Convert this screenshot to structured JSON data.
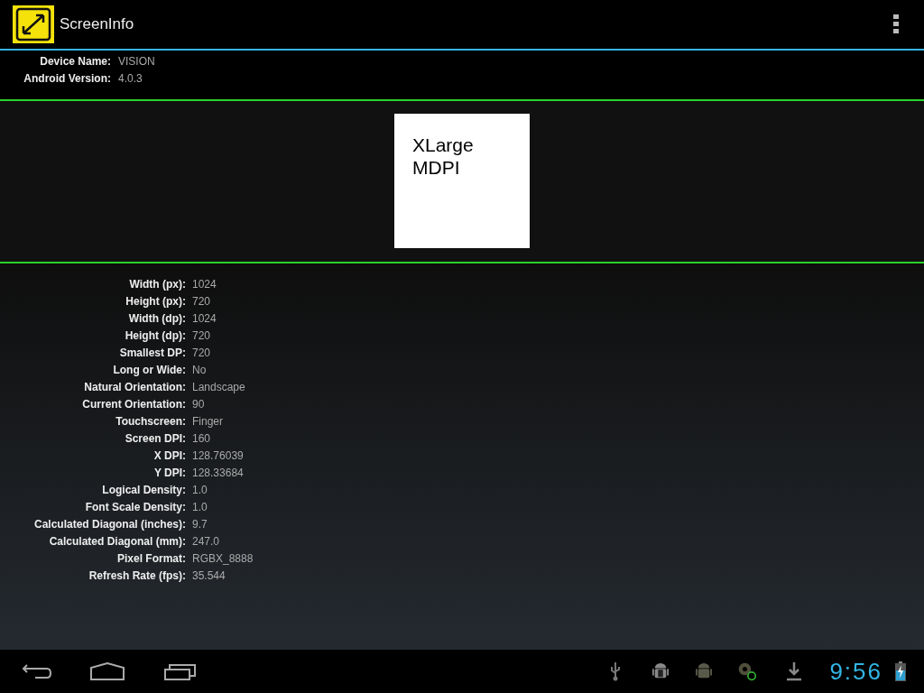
{
  "action_bar": {
    "title": "ScreenInfo"
  },
  "device_info": [
    {
      "label": "Device Name:",
      "value": "VISION"
    },
    {
      "label": "Android Version:",
      "value": "4.0.3"
    }
  ],
  "screen_class": {
    "size": "XLarge",
    "density": "MDPI"
  },
  "properties": [
    {
      "label": "Width (px):",
      "value": "1024"
    },
    {
      "label": "Height (px):",
      "value": "720"
    },
    {
      "label": "Width (dp):",
      "value": "1024"
    },
    {
      "label": "Height (dp):",
      "value": "720"
    },
    {
      "label": "Smallest DP:",
      "value": "720"
    },
    {
      "label": "Long or Wide:",
      "value": "No"
    },
    {
      "label": "Natural Orientation:",
      "value": "Landscape"
    },
    {
      "label": "Current Orientation:",
      "value": "90"
    },
    {
      "label": "Touchscreen:",
      "value": "Finger"
    },
    {
      "label": "Screen DPI:",
      "value": "160"
    },
    {
      "label": "X DPI:",
      "value": "128.76039"
    },
    {
      "label": "Y DPI:",
      "value": "128.33684"
    },
    {
      "label": "Logical Density:",
      "value": "1.0"
    },
    {
      "label": "Font Scale Density:",
      "value": "1.0"
    },
    {
      "label": "Calculated Diagonal (inches):",
      "value": "9.7"
    },
    {
      "label": "Calculated Diagonal (mm):",
      "value": "247.0"
    },
    {
      "label": "Pixel Format:",
      "value": "RGBX_8888"
    },
    {
      "label": "Refresh Rate (fps):",
      "value": "35.544"
    }
  ],
  "system_bar": {
    "clock": "9:56"
  }
}
